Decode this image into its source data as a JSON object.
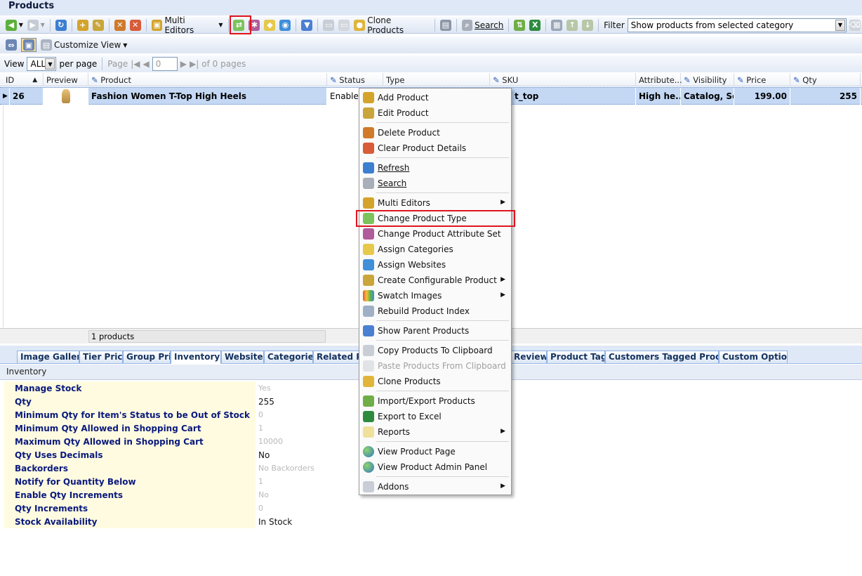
{
  "page_title": "Products",
  "toolbar": {
    "multi_editors": "Multi Editors",
    "clone_products": "Clone Products",
    "search": "Search",
    "filter_label": "Filter",
    "filter_value": "Show products from selected category"
  },
  "toolbar2": {
    "customize_view": "Customize View"
  },
  "pager": {
    "view_label": "View",
    "view_value": "ALL",
    "per_page": "per page",
    "page_label": "Page",
    "page_value": "0",
    "of_pages": "of 0 pages"
  },
  "grid": {
    "columns": [
      "ID",
      "Preview",
      "Product",
      "Status",
      "Type",
      "SKU",
      "Attribute...",
      "Visibility",
      "Price",
      "Qty"
    ],
    "row": {
      "id": "26",
      "product": "Fashion Women T-Top High Heels",
      "status": "Enabled",
      "sku": "t_top",
      "attribute": "High he...",
      "visibility": "Catalog, Se...",
      "price": "199.00",
      "qty": "255"
    },
    "footer": "1 products"
  },
  "tabs": [
    "Image Gallery",
    "Tier Price",
    "Group Price",
    "Inventory",
    "Websites",
    "Categories",
    "Related Pr",
    "Reviews",
    "Product Tags",
    "Customers Tagged Product",
    "Custom Options"
  ],
  "inventory": {
    "title": "Inventory",
    "rows": [
      {
        "label": "Manage Stock",
        "value": "Yes"
      },
      {
        "label": "Qty",
        "value": "255"
      },
      {
        "label": "Minimum Qty for Item's Status to be Out of Stock",
        "value": "0"
      },
      {
        "label": "Minimum Qty Allowed in Shopping Cart",
        "value": "1"
      },
      {
        "label": "Maximum Qty Allowed in Shopping Cart",
        "value": "10000"
      },
      {
        "label": "Qty Uses Decimals",
        "value": "No"
      },
      {
        "label": "Backorders",
        "value": "No Backorders"
      },
      {
        "label": "Notify for Quantity Below",
        "value": "1"
      },
      {
        "label": "Enable Qty Increments",
        "value": "No"
      },
      {
        "label": "Qty Increments",
        "value": "0"
      },
      {
        "label": "Stock Availability",
        "value": "In Stock"
      }
    ]
  },
  "context_menu": [
    {
      "label": "Add Product"
    },
    {
      "label": "Edit Product"
    },
    {
      "label": "Delete Product"
    },
    {
      "label": "Clear Product Details"
    },
    {
      "label": "Refresh"
    },
    {
      "label": "Search"
    },
    {
      "label": "Multi Editors"
    },
    {
      "label": "Change Product Type"
    },
    {
      "label": "Change Product Attribute Set"
    },
    {
      "label": "Assign Categories"
    },
    {
      "label": "Assign Websites"
    },
    {
      "label": "Create Configurable Product"
    },
    {
      "label": "Swatch Images"
    },
    {
      "label": "Rebuild Product Index"
    },
    {
      "label": "Show Parent Products"
    },
    {
      "label": "Copy Products To Clipboard"
    },
    {
      "label": "Paste Products From Clipboard"
    },
    {
      "label": "Clone Products"
    },
    {
      "label": "Import/Export Products"
    },
    {
      "label": "Export to Excel"
    },
    {
      "label": "Reports"
    },
    {
      "label": "View Product Page"
    },
    {
      "label": "View Product Admin Panel"
    },
    {
      "label": "Addons"
    }
  ],
  "colors": {
    "highlight": "#e0141e",
    "selected_row": "#c4d8f4",
    "label_text": "#0a1a7e"
  }
}
